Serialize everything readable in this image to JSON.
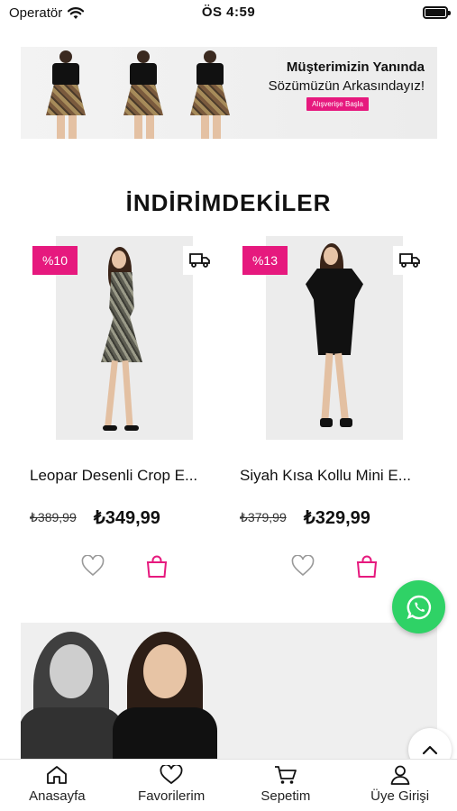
{
  "status_bar": {
    "carrier": "Operatör",
    "time": "ÖS 4:59"
  },
  "hero_banner": {
    "headline": "Müşterimizin Yanında",
    "subline": "Sözümüzün Arkasındayız!",
    "cta_label": "Alışverişe Başla"
  },
  "section": {
    "title": "İNDİRİMDEKİLER"
  },
  "products": [
    {
      "discount": "%10",
      "name": "Leopar Desenli Crop E...",
      "old_price": "₺389,99",
      "price": "₺349,99"
    },
    {
      "discount": "%13",
      "name": "Siyah Kısa Kollu Mini E...",
      "old_price": "₺379,99",
      "price": "₺329,99"
    }
  ],
  "colors": {
    "accent": "#e6197e",
    "whatsapp": "#2fd266"
  },
  "icons": [
    "wifi-icon",
    "battery-icon",
    "truck-icon",
    "heart-icon",
    "shopping-bag-icon",
    "whatsapp-icon",
    "chevron-up-icon",
    "home-icon",
    "cart-icon",
    "user-icon"
  ],
  "tabbar": {
    "items": [
      {
        "label": "Anasayfa"
      },
      {
        "label": "Favorilerim"
      },
      {
        "label": "Sepetim"
      },
      {
        "label": "Üye Girişi"
      }
    ]
  }
}
